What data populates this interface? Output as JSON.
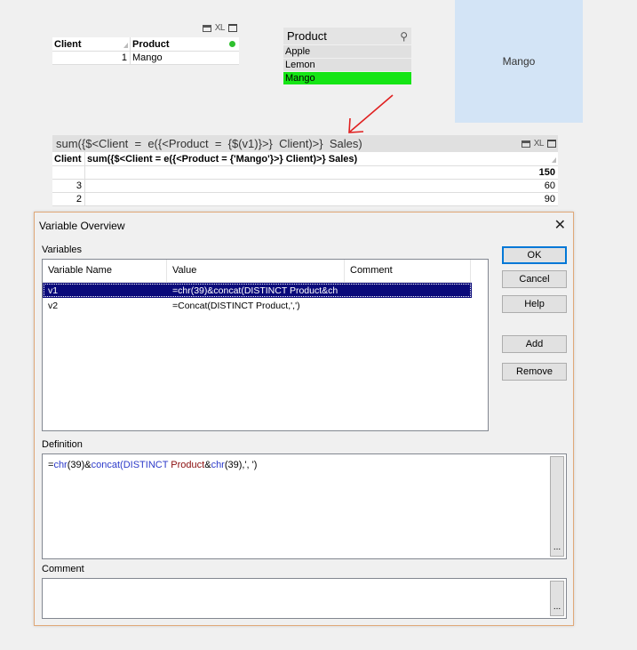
{
  "table1": {
    "headers": [
      "Client",
      "Product"
    ],
    "rows": [
      {
        "client": "1",
        "product": "Mango"
      }
    ],
    "caption_icons": [
      "print-icon",
      "xl-icon",
      "maximize-icon"
    ],
    "xl_label": "XL"
  },
  "listbox": {
    "title": "Product",
    "items": [
      {
        "label": "Apple",
        "state": "available"
      },
      {
        "label": "Lemon",
        "state": "available"
      },
      {
        "label": "Mango",
        "state": "selected"
      }
    ],
    "selected_color": "#15e515"
  },
  "textobject": {
    "text": "Mango",
    "bg_color": "#d3e4f6"
  },
  "table2": {
    "caption": "sum({$<Client  =  e({<Product  =  {$(v1)}>}  Client)>}  Sales)",
    "headers": [
      "Client",
      "sum({$<Client = e({<Product = {'Mango'}>} Client)>} Sales)"
    ],
    "total": "150",
    "rows": [
      {
        "client": "3",
        "value": "60"
      },
      {
        "client": "2",
        "value": "90"
      }
    ],
    "xl_label": "XL"
  },
  "dialog": {
    "title": "Variable Overview",
    "variables_label": "Variables",
    "columns": [
      "Variable Name",
      "Value",
      "Comment"
    ],
    "variables": [
      {
        "name": "v1",
        "value": "=chr(39)&concat(DISTINCT Product&ch",
        "comment": "",
        "selected": true
      },
      {
        "name": "v2",
        "value": "=Concat(DISTINCT Product,',')",
        "comment": "",
        "selected": false
      }
    ],
    "buttons": {
      "ok": "OK",
      "cancel": "Cancel",
      "help": "Help",
      "add": "Add",
      "remove": "Remove"
    },
    "definition_label": "Definition",
    "definition_parts": {
      "p1": "=",
      "p2": "chr",
      "p3": "(39)&",
      "p4": "concat",
      "p5": "(DISTINCT ",
      "p6": "Product",
      "p7": "&",
      "p8": "chr",
      "p9": "(39),', ')"
    },
    "comment_label": "Comment",
    "ellipsis": "..."
  }
}
